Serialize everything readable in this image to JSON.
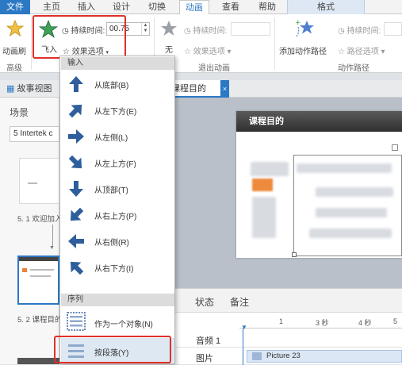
{
  "tabs": [
    {
      "label": "文件",
      "active": false
    },
    {
      "label": "主页",
      "active": false
    },
    {
      "label": "插入",
      "active": false
    },
    {
      "label": "设计",
      "active": false
    },
    {
      "label": "切换",
      "active": false
    },
    {
      "label": "动画",
      "active": true
    },
    {
      "label": "查看",
      "active": false
    },
    {
      "label": "帮助",
      "active": false
    },
    {
      "label": "格式",
      "active": false
    }
  ],
  "ribbon": {
    "fly_in_label": "飞入",
    "anim_brush_label": "动画刷",
    "advanced_label": "高级",
    "duration_label": "持续时间:",
    "duration_value": "00.75",
    "effect_options_label": "效果选项",
    "none_label": "无",
    "exit_duration_label": "持续时间:",
    "exit_effect_options_label": "效果选项",
    "exit_group_label": "退出动画",
    "add_path_label": "添加动作路径",
    "path_duration_label": "持续时间:",
    "path_options_label": "路径选项",
    "path_group_label": "动作路径"
  },
  "left": {
    "story_tab": "故事视图",
    "scenes_label": "场景",
    "scene_select": "5 Intertek c",
    "slide1_label": "5. 1 欢迎加入",
    "slide2_label": "5. 2 课程目的"
  },
  "stage": {
    "tab_label": "课程目的",
    "slide_title": "课程目的"
  },
  "menu": {
    "section_enter": "输入",
    "items": [
      {
        "label": "从底部(B)",
        "icon": "arrow-up-icon"
      },
      {
        "label": "从左下方(E)",
        "icon": "arrow-up-right-icon"
      },
      {
        "label": "从左侧(L)",
        "icon": "arrow-right-icon"
      },
      {
        "label": "从左上方(F)",
        "icon": "arrow-down-right-icon"
      },
      {
        "label": "从顶部(T)",
        "icon": "arrow-down-icon"
      },
      {
        "label": "从右上方(P)",
        "icon": "arrow-down-left-icon"
      },
      {
        "label": "从右侧(R)",
        "icon": "arrow-left-icon"
      },
      {
        "label": "从右下方(I)",
        "icon": "arrow-up-left-icon"
      }
    ],
    "section_sequence": "序列",
    "seq_items": [
      {
        "label": "作为一个对象(N)"
      },
      {
        "label": "按段落(Y)"
      }
    ]
  },
  "timeline": {
    "tabs": [
      "状态",
      "备注"
    ],
    "ticks": [
      "1",
      "3 秒",
      "4 秒",
      "5"
    ],
    "rows": [
      {
        "label": "音频 1"
      },
      {
        "label": "图片"
      }
    ],
    "clip_label": "Picture 23"
  },
  "colors": {
    "accent": "#2b78c5",
    "highlight": "#e0302a",
    "arrow": "#2e5e9c"
  }
}
